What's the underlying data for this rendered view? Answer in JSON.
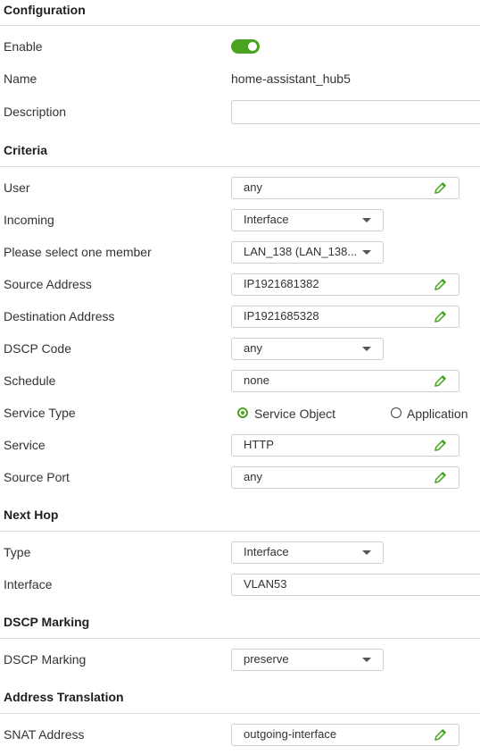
{
  "configuration": {
    "title": "Configuration",
    "enable_label": "Enable",
    "enable_state": true,
    "name_label": "Name",
    "name_value": "home-assistant_hub5",
    "description_label": "Description",
    "description_value": ""
  },
  "criteria": {
    "title": "Criteria",
    "user_label": "User",
    "user_value": "any",
    "incoming_label": "Incoming",
    "incoming_value": "Interface",
    "member_label": "Please select one member",
    "member_value": "LAN_138 (LAN_138...",
    "source_address_label": "Source Address",
    "source_address_value": "IP1921681382",
    "destination_address_label": "Destination Address",
    "destination_address_value": "IP1921685328",
    "dscp_code_label": "DSCP Code",
    "dscp_code_value": "any",
    "schedule_label": "Schedule",
    "schedule_value": "none",
    "service_type_label": "Service Type",
    "service_type_options": [
      "Service Object",
      "Application"
    ],
    "service_type_selected": "Service Object",
    "service_label": "Service",
    "service_value": "HTTP",
    "source_port_label": "Source Port",
    "source_port_value": "any"
  },
  "next_hop": {
    "title": "Next Hop",
    "type_label": "Type",
    "type_value": "Interface",
    "interface_label": "Interface",
    "interface_value": "VLAN53"
  },
  "dscp_marking": {
    "title": "DSCP Marking",
    "marking_label": "DSCP Marking",
    "marking_value": "preserve"
  },
  "address_translation": {
    "title": "Address Translation",
    "snat_label": "SNAT Address",
    "snat_value": "outgoing-interface"
  },
  "colors": {
    "accent": "#4aa421",
    "divider": "#dcdcdc",
    "text": "#333333"
  },
  "icons": {
    "edit": "pencil-icon",
    "dropdown": "chevron-down-icon"
  }
}
